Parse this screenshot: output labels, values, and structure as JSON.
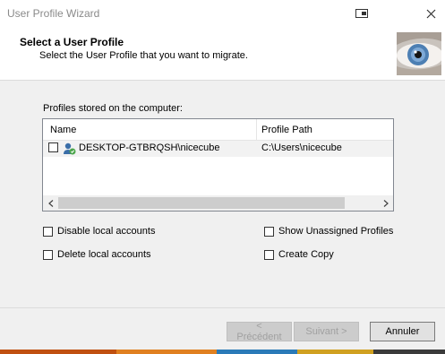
{
  "window": {
    "title": "User Profile Wizard"
  },
  "header": {
    "title": "Select a User Profile",
    "subtitle": "Select the User Profile that you want to migrate."
  },
  "profiles": {
    "group_label": "Profiles stored on the computer:",
    "columns": {
      "name": "Name",
      "path": "Profile Path"
    },
    "rows": [
      {
        "name": "DESKTOP-GTBRQSH\\nicecube",
        "path": "C:\\Users\\nicecube",
        "checked": false
      }
    ]
  },
  "options": {
    "disable_local": "Disable local accounts",
    "delete_local": "Delete local accounts",
    "show_unassigned": "Show Unassigned Profiles",
    "create_copy": "Create Copy"
  },
  "buttons": {
    "previous": "< Précédent",
    "next": "Suivant >",
    "cancel": "Annuler"
  },
  "icons": {
    "restore": "restore-window-icon",
    "close": "close-icon",
    "header_image": "eye-image",
    "user": "user-profile-icon"
  },
  "colors": {
    "dialog_bg": "#f0f0f0",
    "header_bg": "#ffffff",
    "row_bg": "#f2f2f2",
    "taskbar": [
      "#c05010",
      "#e08020",
      "#2a7ab8",
      "#d0a020",
      "#3a3a3a"
    ]
  }
}
